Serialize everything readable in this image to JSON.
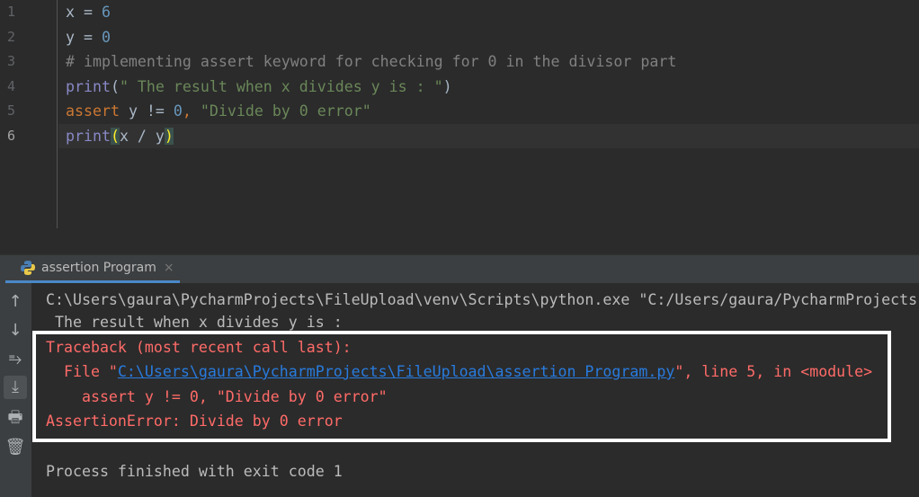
{
  "editor": {
    "line_numbers": [
      "1",
      "2",
      "3",
      "4",
      "5",
      "6"
    ],
    "lines": [
      {
        "a": "x = ",
        "b": "6"
      },
      {
        "a": "y = ",
        "b": "0"
      },
      {
        "comment": "# implementing assert keyword for checking for 0 in the divisor part"
      },
      {
        "fn": "print",
        "open": "(",
        "str": "\" The result when x divides y is : \"",
        "close": ")"
      },
      {
        "kw": "assert",
        "mid": " y != ",
        "num": "0",
        "comma": ", ",
        "str": "\"Divide by 0 error\""
      },
      {
        "fn": "print",
        "open": "(",
        "mid": "x / y",
        "close": ")"
      }
    ]
  },
  "run_tab": {
    "label": "assertion Program",
    "close": "×"
  },
  "toolbar": {
    "up": "↑",
    "down": "↓",
    "wrap": "⥱",
    "scroll_end": "⤓",
    "print": "🖶",
    "trash": "🗑"
  },
  "console": {
    "cmd": "C:\\Users\\gaura\\PycharmProjects\\FileUpload\\venv\\Scripts\\python.exe \"C:/Users/gaura/PycharmProjects",
    "output": " The result when x divides y is :",
    "tb1": "Traceback (most recent call last):",
    "tb2_pre": "  File \"",
    "tb2_link": "C:\\Users\\gaura\\PycharmProjects\\FileUpload\\assertion Program.py",
    "tb2_post": "\", line 5, in <module>",
    "tb3": "    assert y != 0, \"Divide by 0 error\"",
    "tb4": "AssertionError: Divide by 0 error",
    "exit": "Process finished with exit code 1"
  }
}
